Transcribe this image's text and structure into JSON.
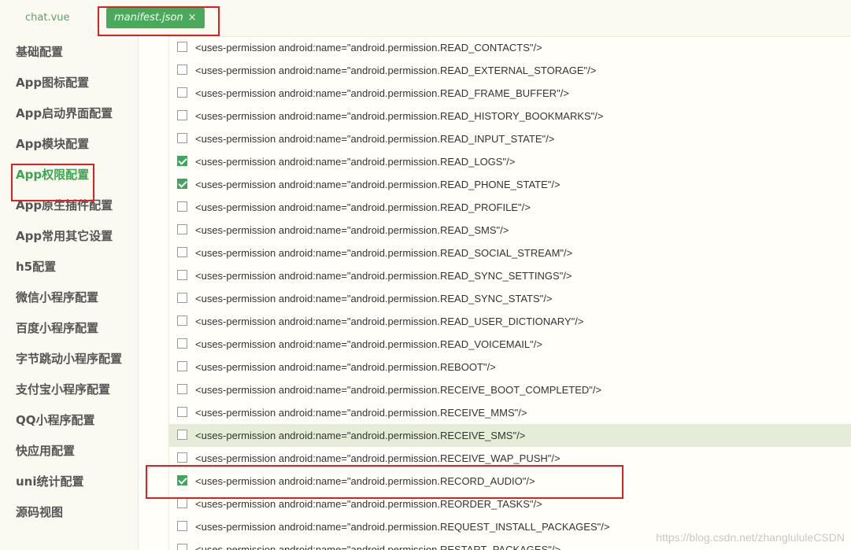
{
  "tabs": [
    {
      "label": "chat.vue"
    },
    {
      "label": "manifest.json",
      "close": "×"
    }
  ],
  "sidebar": {
    "items": [
      {
        "label": "基础配置"
      },
      {
        "label": "App图标配置"
      },
      {
        "label": "App启动界面配置"
      },
      {
        "label": "App模块配置"
      },
      {
        "label": "App权限配置"
      },
      {
        "label": "App原生插件配置"
      },
      {
        "label": "App常用其它设置"
      },
      {
        "label": "h5配置"
      },
      {
        "label": "微信小程序配置"
      },
      {
        "label": "百度小程序配置"
      },
      {
        "label": "字节跳动小程序配置"
      },
      {
        "label": "支付宝小程序配置"
      },
      {
        "label": "QQ小程序配置"
      },
      {
        "label": "快应用配置"
      },
      {
        "label": "uni统计配置"
      },
      {
        "label": "源码视图"
      }
    ],
    "active": "App权限配置"
  },
  "permissions": [
    {
      "text": "<uses-permission android:name=\"android.permission.READ_CONTACTS\"/>",
      "checked": false
    },
    {
      "text": "<uses-permission android:name=\"android.permission.READ_EXTERNAL_STORAGE\"/>",
      "checked": false
    },
    {
      "text": "<uses-permission android:name=\"android.permission.READ_FRAME_BUFFER\"/>",
      "checked": false
    },
    {
      "text": "<uses-permission android:name=\"android.permission.READ_HISTORY_BOOKMARKS\"/>",
      "checked": false
    },
    {
      "text": "<uses-permission android:name=\"android.permission.READ_INPUT_STATE\"/>",
      "checked": false
    },
    {
      "text": "<uses-permission android:name=\"android.permission.READ_LOGS\"/>",
      "checked": true
    },
    {
      "text": "<uses-permission android:name=\"android.permission.READ_PHONE_STATE\"/>",
      "checked": true
    },
    {
      "text": "<uses-permission android:name=\"android.permission.READ_PROFILE\"/>",
      "checked": false
    },
    {
      "text": "<uses-permission android:name=\"android.permission.READ_SMS\"/>",
      "checked": false
    },
    {
      "text": "<uses-permission android:name=\"android.permission.READ_SOCIAL_STREAM\"/>",
      "checked": false
    },
    {
      "text": "<uses-permission android:name=\"android.permission.READ_SYNC_SETTINGS\"/>",
      "checked": false
    },
    {
      "text": "<uses-permission android:name=\"android.permission.READ_SYNC_STATS\"/>",
      "checked": false
    },
    {
      "text": "<uses-permission android:name=\"android.permission.READ_USER_DICTIONARY\"/>",
      "checked": false
    },
    {
      "text": "<uses-permission android:name=\"android.permission.READ_VOICEMAIL\"/>",
      "checked": false
    },
    {
      "text": "<uses-permission android:name=\"android.permission.REBOOT\"/>",
      "checked": false
    },
    {
      "text": "<uses-permission android:name=\"android.permission.RECEIVE_BOOT_COMPLETED\"/>",
      "checked": false
    },
    {
      "text": "<uses-permission android:name=\"android.permission.RECEIVE_MMS\"/>",
      "checked": false
    },
    {
      "text": "<uses-permission android:name=\"android.permission.RECEIVE_SMS\"/>",
      "checked": false,
      "hovered": true
    },
    {
      "text": "<uses-permission android:name=\"android.permission.RECEIVE_WAP_PUSH\"/>",
      "checked": false
    },
    {
      "text": "<uses-permission android:name=\"android.permission.RECORD_AUDIO\"/>",
      "checked": true
    },
    {
      "text": "<uses-permission android:name=\"android.permission.REORDER_TASKS\"/>",
      "checked": false
    },
    {
      "text": "<uses-permission android:name=\"android.permission.REQUEST_INSTALL_PACKAGES\"/>",
      "checked": false
    },
    {
      "text": "<uses-permission android:name=\"android.permission.RESTART_PACKAGES\"/>",
      "checked": false
    }
  ],
  "watermark": "https://blog.csdn.net/zhanglululeCSDN",
  "colors": {
    "accent": "#48aa5a",
    "highlight_box": "#e02020",
    "hover_row": "#e5ecd8"
  }
}
